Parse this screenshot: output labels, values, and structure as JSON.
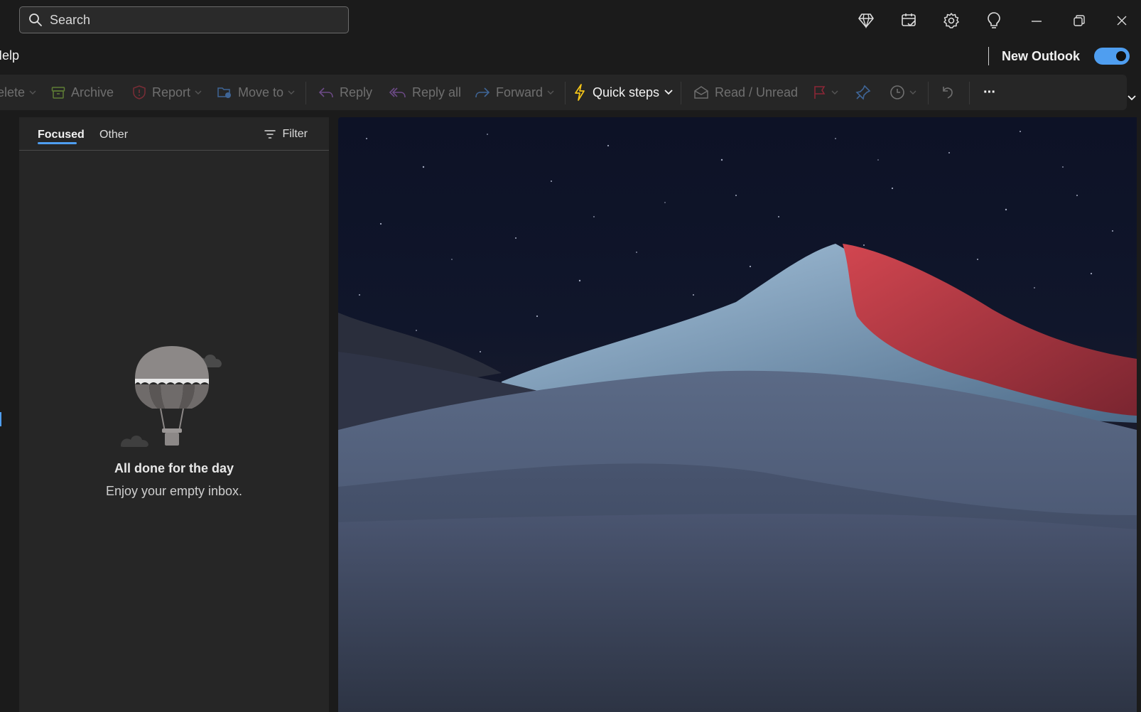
{
  "search": {
    "placeholder": "Search"
  },
  "menu": {
    "help_label": "Help"
  },
  "new_outlook": {
    "label": "New Outlook",
    "enabled": true
  },
  "ribbon": {
    "delete_label": "Delete",
    "archive_label": "Archive",
    "report_label": "Report",
    "move_to_label": "Move to",
    "reply_label": "Reply",
    "reply_all_label": "Reply all",
    "forward_label": "Forward",
    "quick_steps_label": "Quick steps",
    "read_unread_label": "Read / Unread",
    "more_label": "···"
  },
  "tabs": {
    "focused_label": "Focused",
    "other_label": "Other",
    "filter_label": "Filter"
  },
  "empty_state": {
    "title": "All done for the day",
    "subtitle": "Enjoy your empty inbox."
  },
  "icons": {
    "titlebar": [
      "premium-diamond-icon",
      "my-day-icon",
      "settings-gear-icon",
      "tips-lightbulb-icon",
      "minimize-icon",
      "restore-icon",
      "close-icon"
    ],
    "ribbon": [
      "archive-icon",
      "report-shield-icon",
      "move-folder-icon",
      "reply-icon",
      "reply-all-icon",
      "forward-icon",
      "quick-steps-lightning-icon",
      "envelope-icon",
      "flag-icon",
      "pin-icon",
      "snooze-clock-icon",
      "undo-icon",
      "more-icon"
    ]
  },
  "colors": {
    "accent": "#4f9ef0",
    "quick_steps": "#f5c518",
    "flag": "#c4314b",
    "archive": "#6a8f3a"
  }
}
